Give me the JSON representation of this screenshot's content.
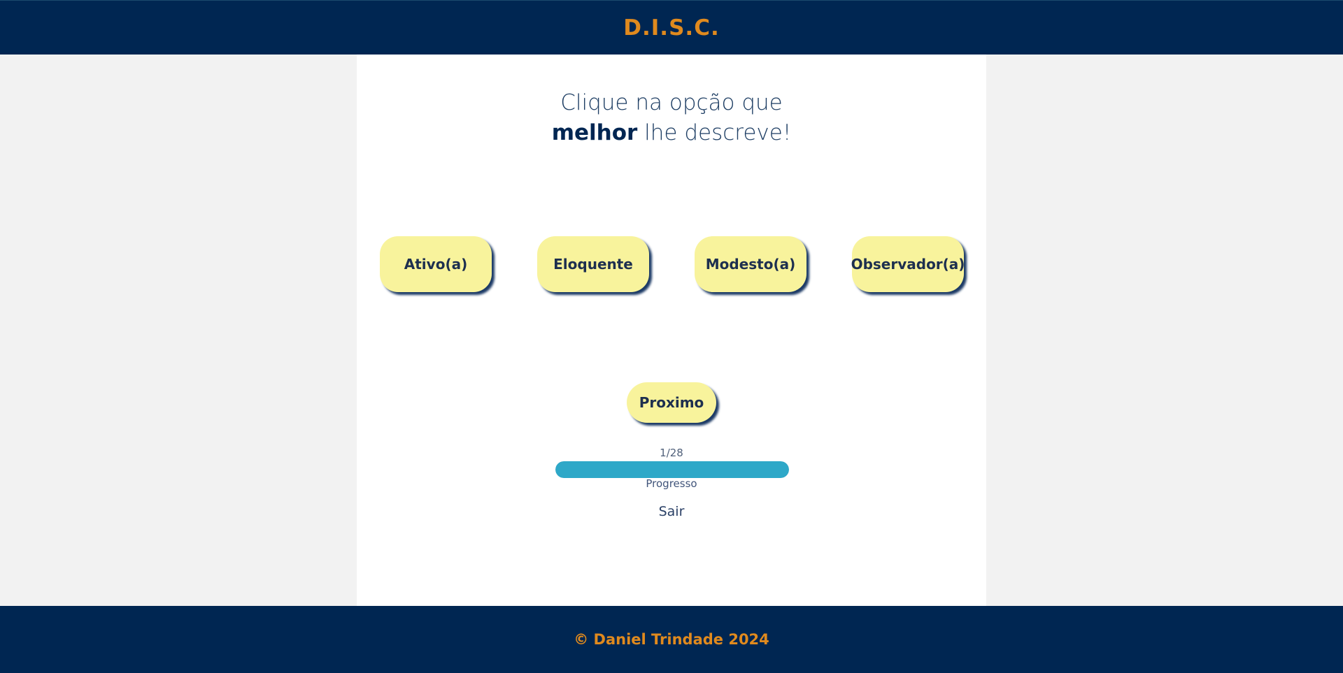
{
  "header": {
    "brand": "D.I.S.C."
  },
  "prompt": {
    "line1": "Clique na opção que",
    "emphasis": "melhor",
    "line2_rest": " lhe descreve!"
  },
  "options": [
    {
      "label": "Ativo(a)"
    },
    {
      "label": "Eloquente"
    },
    {
      "label": "Modesto(a)"
    },
    {
      "label": "Observador(a)"
    }
  ],
  "next_button": {
    "label": "Proximo"
  },
  "progress": {
    "counter": "1/28",
    "value": 1,
    "total": 28,
    "fill_fraction": 1.0,
    "label": "Progresso"
  },
  "exit_link": {
    "label": "Sair"
  },
  "footer": {
    "copyright": "© Daniel Trindade 2024"
  },
  "colors": {
    "navy": "#002652",
    "accent_orange": "#e08a1e",
    "button_yellow": "#f8f39c",
    "progress_teal": "#2ea8c8"
  }
}
